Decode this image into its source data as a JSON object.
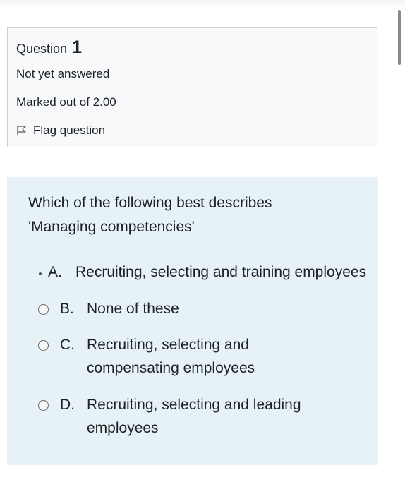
{
  "info": {
    "question_label": "Question",
    "question_number": "1",
    "state": "Not yet answered",
    "grade": "Marked out of 2.00",
    "flag_label": "Flag question"
  },
  "question": {
    "text_line1": "Which of the following best describes",
    "text_line2": "'Managing competencies'",
    "options": [
      {
        "letter": "A.",
        "text": "Recruiting, selecting and training employees"
      },
      {
        "letter": "B.",
        "text": "None of these"
      },
      {
        "letter": "C.",
        "text_line1": "Recruiting, selecting and",
        "text_line2": "compensating employees"
      },
      {
        "letter": "D.",
        "text_line1": "Recruiting, selecting and leading",
        "text_line2": "employees"
      }
    ]
  }
}
